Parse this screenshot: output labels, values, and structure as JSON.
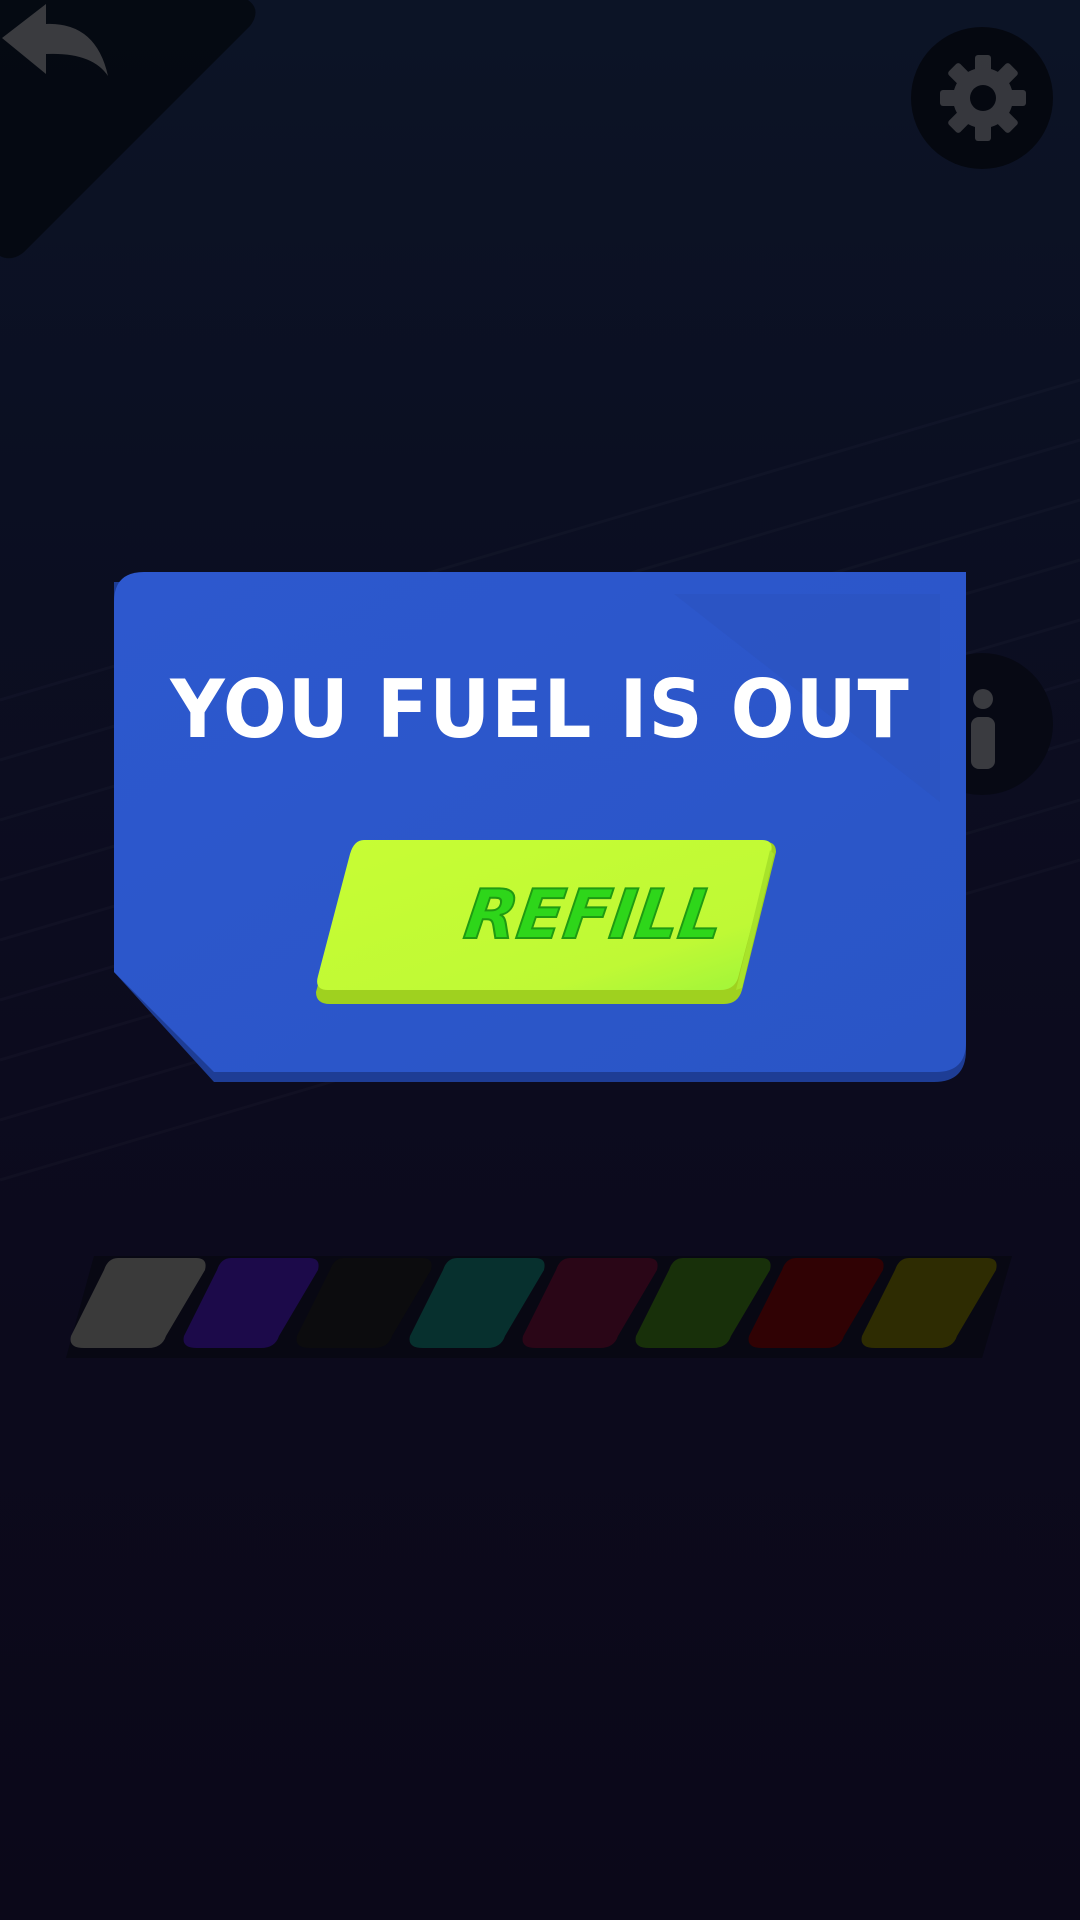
{
  "dialog": {
    "title": "YOU FUEL IS OUT",
    "refill_label": "REFILL"
  },
  "icons": {
    "back": "back-arrow-icon",
    "settings": "gear-icon",
    "info": "info-icon"
  },
  "swatches": [
    {
      "name": "gray",
      "color": "#3a3a3a"
    },
    {
      "name": "purple",
      "color": "#1c0a4a"
    },
    {
      "name": "black",
      "color": "#0c0c0e"
    },
    {
      "name": "teal",
      "color": "#07302e"
    },
    {
      "name": "maroon",
      "color": "#2a0617"
    },
    {
      "name": "dark-green",
      "color": "#18300a"
    },
    {
      "name": "dark-red",
      "color": "#300204"
    },
    {
      "name": "olive",
      "color": "#2e2c02"
    }
  ],
  "colors": {
    "dialog_blue": "#2d58c9",
    "button_lime": "#c4fb32",
    "button_text": "#2ed61a"
  }
}
